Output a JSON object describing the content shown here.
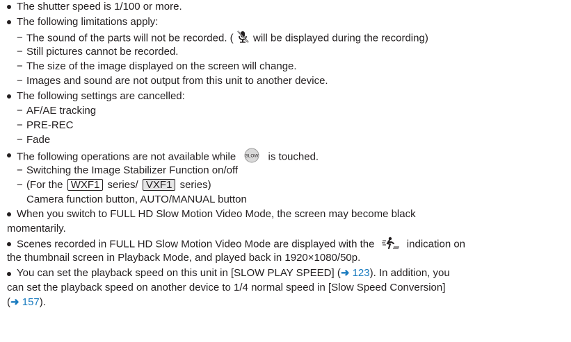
{
  "colors": {
    "text": "#231f20",
    "link": "#1a7bbf"
  },
  "b1": "The shutter speed is 1/100 or more.",
  "b2": "The following limitations apply:",
  "b2_items": {
    "i1_pre": "The sound of the parts will not be recorded. (",
    "i1_post": "will be displayed during the recording)",
    "i2": "Still pictures cannot be recorded.",
    "i3": "The size of the image displayed on the screen will change.",
    "i4": "Images and sound are not output from this unit to another device."
  },
  "b3": "The following settings are cancelled:",
  "b3_items": [
    "AF/AE tracking",
    "PRE-REC",
    "Fade"
  ],
  "b4_pre": "The following operations are not available while",
  "b4_post": "is touched.",
  "b4_items": {
    "i1": "Switching the Image Stabilizer Function on/off",
    "i2_pre": "(For the",
    "model1": "WXF1",
    "i2_mid": "series/",
    "model2": "VXF1",
    "i2_post": "series)",
    "i2_cont": "Camera function button, AUTO/MANUAL button"
  },
  "slow_icon_label": "SLOW",
  "b5_l1": "When you switch to FULL HD Slow Motion Video Mode, the screen may become black",
  "b5_l2": "momentarily.",
  "b6_l1_pre": "Scenes recorded in FULL HD Slow Motion Video Mode are displayed with the",
  "b6_l1_post": "indication on",
  "b6_l2": "the thumbnail screen in Playback Mode, and played back in 1920×1080/50p.",
  "b7_l1_pre": "You can set the playback speed on this unit in [SLOW PLAY SPEED] (",
  "b7_arrow": "➜",
  "b7_ref1": "123",
  "b7_l1_post": "). In addition, you",
  "b7_l2": "can set the playback speed on another device to 1/4 normal speed in [Slow Speed Conversion]",
  "b7_l3_pre": "(",
  "b7_ref2": "157",
  "b7_l3_post": ")."
}
